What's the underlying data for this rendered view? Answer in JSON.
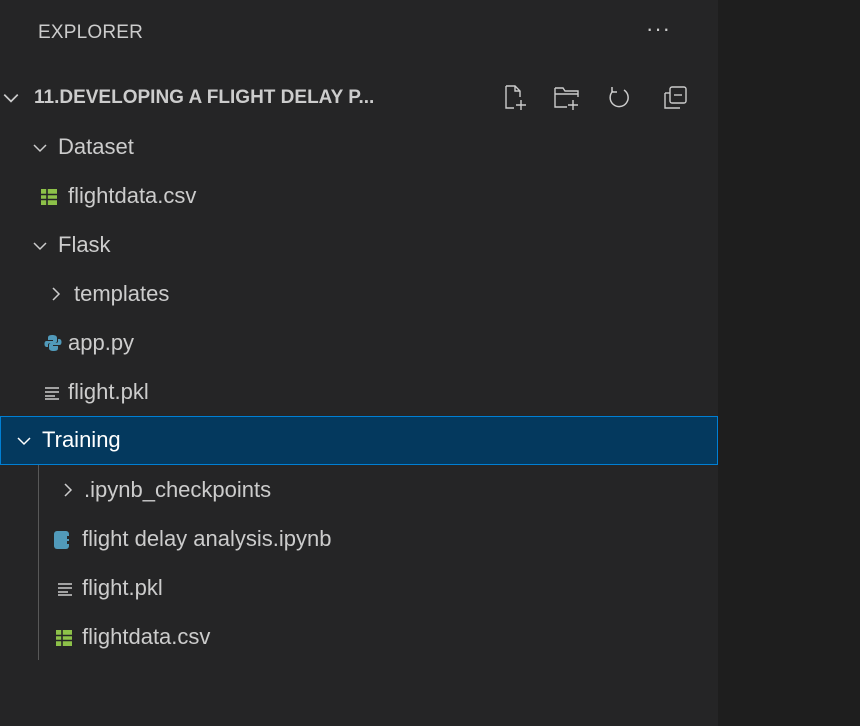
{
  "explorer": {
    "header_title": "EXPLORER",
    "more_label": "···",
    "section_title": "11.DEVELOPING A FLIGHT DELAY P...",
    "toolbar": [
      {
        "name": "new-file-icon"
      },
      {
        "name": "new-folder-icon"
      },
      {
        "name": "refresh-icon"
      },
      {
        "name": "collapse-all-icon"
      }
    ],
    "tree": [
      {
        "label": "Dataset",
        "type": "folder",
        "expanded": true,
        "depth": 0
      },
      {
        "label": "flightdata.csv",
        "type": "csv",
        "depth": 1
      },
      {
        "label": "Flask",
        "type": "folder",
        "expanded": true,
        "depth": 0
      },
      {
        "label": "templates",
        "type": "folder",
        "expanded": false,
        "depth": 1
      },
      {
        "label": "app.py",
        "type": "python",
        "depth": 1
      },
      {
        "label": "flight.pkl",
        "type": "text",
        "depth": 1
      },
      {
        "label": "Training",
        "type": "folder",
        "expanded": true,
        "depth": 0,
        "selected": true
      },
      {
        "label": ".ipynb_checkpoints",
        "type": "folder",
        "expanded": false,
        "depth": 1
      },
      {
        "label": "flight delay analysis.ipynb",
        "type": "notebook",
        "depth": 1
      },
      {
        "label": "flight.pkl",
        "type": "text",
        "depth": 1
      },
      {
        "label": "flightdata.csv",
        "type": "csv",
        "depth": 1
      }
    ]
  },
  "colors": {
    "sidebar_bg": "#252526",
    "editor_bg": "#1e1e1e",
    "selected_bg": "#04395e",
    "selected_border": "#007fd4",
    "csv_icon": "#8dc149",
    "python_icon": "#519aba",
    "notebook_icon": "#519aba",
    "text": "#cccccc"
  }
}
